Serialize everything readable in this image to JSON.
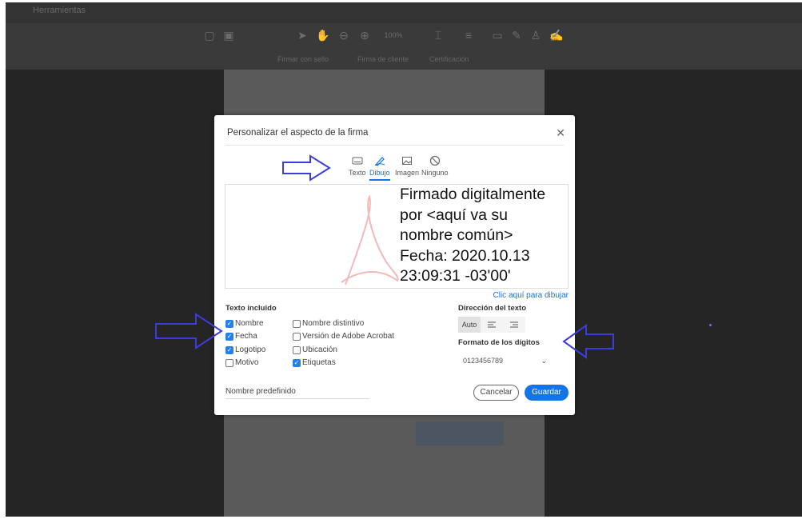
{
  "top_strip": {
    "label": "Herramientas"
  },
  "toolbar": {
    "zoom": "100%",
    "tool_labels": [
      "Firmar con sello",
      "Firma de cliente",
      "Certificación"
    ]
  },
  "dialog": {
    "title": "Personalizar el aspecto de la firma",
    "tabs": [
      {
        "label": "Texto",
        "icon": "keyboard-icon",
        "active": false
      },
      {
        "label": "Dibujo",
        "icon": "pen-draw-icon",
        "active": true
      },
      {
        "label": "Imagen",
        "icon": "image-icon",
        "active": false
      },
      {
        "label": "Ninguno",
        "icon": "none-icon",
        "active": false
      }
    ],
    "preview_lines": [
      "Firmado digitalmente",
      "por <aquí va su",
      "nombre común>",
      "Fecha: 2020.10.13",
      "23:09:31 -03'00'"
    ],
    "draw_link": "Clic aquí para dibujar",
    "included_text": {
      "label": "Texto incluido",
      "options": [
        {
          "label": "Nombre",
          "checked": true
        },
        {
          "label": "Fecha",
          "checked": true
        },
        {
          "label": "Logotipo",
          "checked": true
        },
        {
          "label": "Motivo",
          "checked": false
        },
        {
          "label": "Nombre distintivo",
          "checked": false
        },
        {
          "label": "Versión de Adobe Acrobat",
          "checked": false
        },
        {
          "label": "Ubicación",
          "checked": false
        },
        {
          "label": "Etiquetas",
          "checked": true
        }
      ]
    },
    "text_direction": {
      "label": "Dirección del texto",
      "auto_label": "Auto",
      "selected": "Auto"
    },
    "digit_format": {
      "label": "Formato de los dígitos",
      "value": "0123456789"
    },
    "predefined_name": {
      "label": "Nombre predefinido"
    },
    "cancel_label": "Cancelar",
    "save_label": "Guardar"
  },
  "colors": {
    "accent": "#1473e6",
    "annotation_arrow": "#3c3cdc",
    "backdrop": "#2b2b2b"
  }
}
